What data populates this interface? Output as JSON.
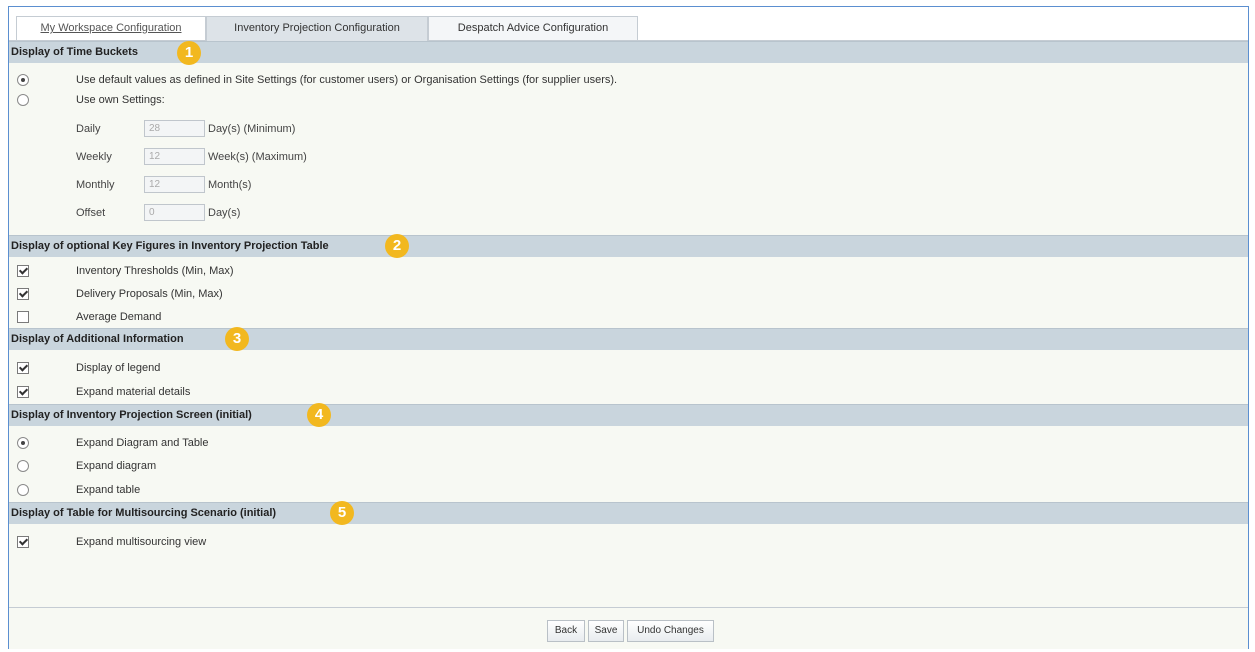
{
  "tabs": [
    {
      "label": "My Workspace Configuration"
    },
    {
      "label": "Inventory Projection Configuration"
    },
    {
      "label": "Despatch Advice Configuration"
    }
  ],
  "badge_color": "#f2b81f",
  "sections": [
    {
      "title": "Display of Time Buckets",
      "badge": "1",
      "options": [
        {
          "label": "Use default values as defined in Site Settings (for customer users) or Organisation Settings (for supplier users).",
          "control": "radio",
          "checked": true
        },
        {
          "label": "Use own Settings:",
          "control": "radio",
          "checked": false
        }
      ],
      "fields": [
        {
          "label": "Daily",
          "value": "28",
          "unit": "Day(s) (Minimum)"
        },
        {
          "label": "Weekly",
          "value": "12",
          "unit": "Week(s) (Maximum)"
        },
        {
          "label": "Monthly",
          "value": "12",
          "unit": "Month(s)"
        },
        {
          "label": "Offset",
          "value": "0",
          "unit": "Day(s)"
        }
      ]
    },
    {
      "title": "Display of optional Key Figures in Inventory Projection Table",
      "badge": "2",
      "options": [
        {
          "label": "Inventory Thresholds (Min, Max)",
          "control": "checkbox",
          "checked": true
        },
        {
          "label": "Delivery Proposals (Min, Max)",
          "control": "checkbox",
          "checked": true
        },
        {
          "label": "Average Demand",
          "control": "checkbox",
          "checked": false
        }
      ]
    },
    {
      "title": "Display of Additional Information",
      "badge": "3",
      "options": [
        {
          "label": "Display of legend",
          "control": "checkbox",
          "checked": true
        },
        {
          "label": "Expand material details",
          "control": "checkbox",
          "checked": true
        }
      ]
    },
    {
      "title": "Display of Inventory Projection Screen (initial)",
      "badge": "4",
      "options": [
        {
          "label": "Expand Diagram and Table",
          "control": "radio",
          "checked": true
        },
        {
          "label": "Expand diagram",
          "control": "radio",
          "checked": false
        },
        {
          "label": "Expand table",
          "control": "radio",
          "checked": false
        }
      ]
    },
    {
      "title": "Display of Table for Multisourcing Scenario (initial)",
      "badge": "5",
      "options": [
        {
          "label": "Expand multisourcing view",
          "control": "checkbox",
          "checked": true
        }
      ]
    }
  ],
  "footer": {
    "back_label": "Back",
    "save_label": "Save",
    "undo_label": "Undo Changes"
  }
}
